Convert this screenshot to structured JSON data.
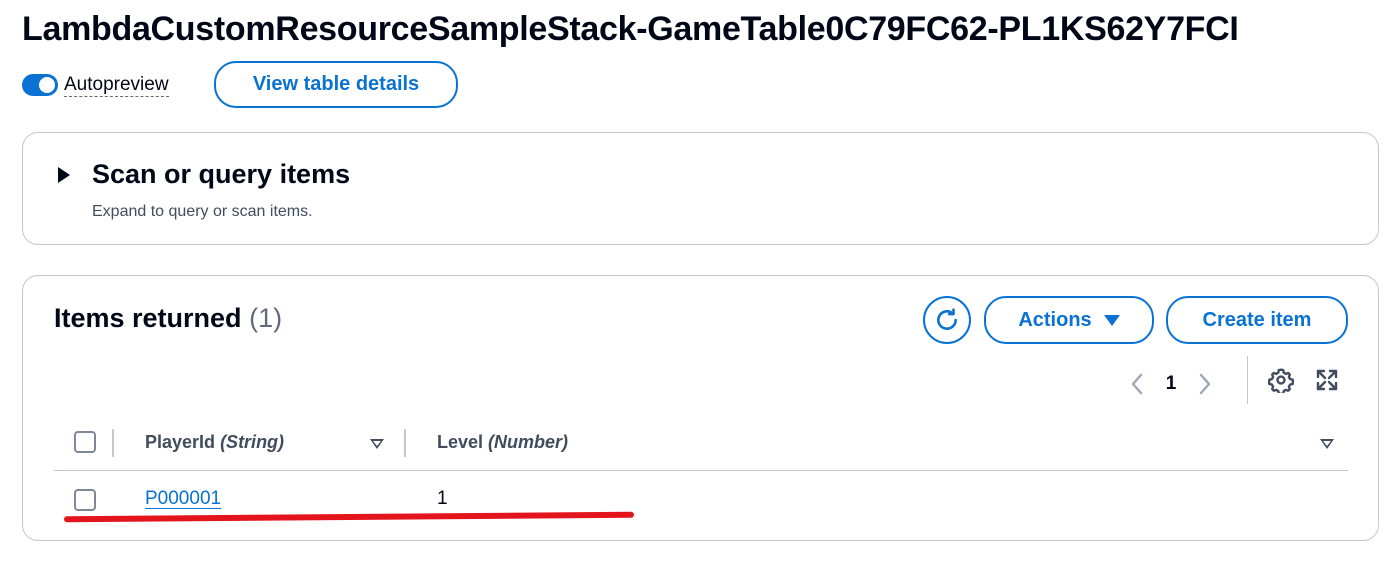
{
  "page": {
    "title": "LambdaCustomResourceSampleStack-GameTable0C79FC62-PL1KS62Y7FCI"
  },
  "toolbar": {
    "autopreview_label": "Autopreview",
    "autopreview_on": true,
    "view_details_label": "View table details"
  },
  "scan_panel": {
    "title": "Scan or query items",
    "subtitle": "Expand to query or scan items."
  },
  "items_panel": {
    "title": "Items returned",
    "count": "(1)",
    "actions_label": "Actions",
    "create_label": "Create item",
    "current_page": "1",
    "columns": [
      {
        "name": "PlayerId",
        "type": "(String)"
      },
      {
        "name": "Level",
        "type": "(Number)"
      }
    ],
    "rows": [
      {
        "player_id": "P000001",
        "level": "1"
      }
    ]
  },
  "colors": {
    "accent": "#0972d3",
    "text": "#000716",
    "border": "#c6c6cd",
    "annotation": "#e3141b"
  }
}
